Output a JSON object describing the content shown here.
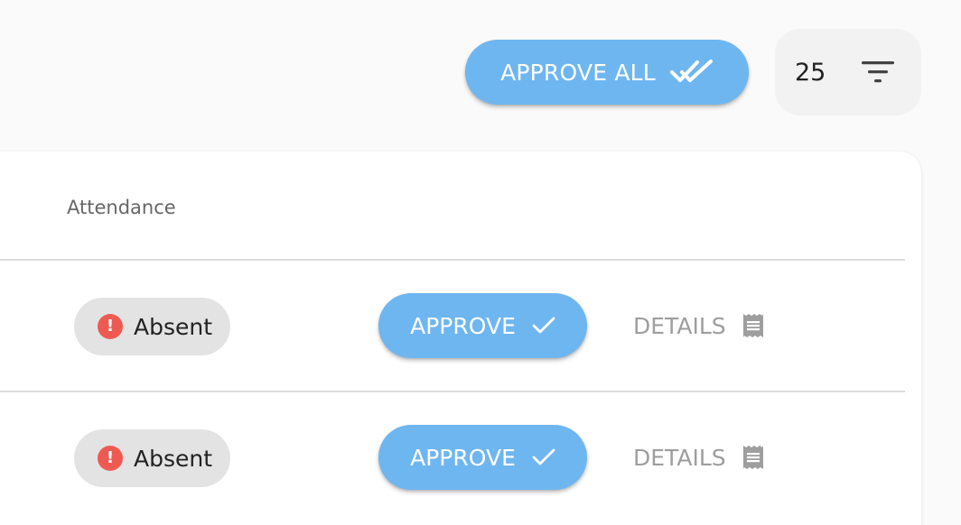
{
  "toolbar": {
    "approve_all_label": "APPROVE ALL",
    "per_page_value": "25"
  },
  "table": {
    "columns": [
      "Attendance"
    ],
    "rows": [
      {
        "status": "Absent",
        "approve_label": "APPROVE",
        "details_label": "DETAILS"
      },
      {
        "status": "Absent",
        "approve_label": "APPROVE",
        "details_label": "DETAILS"
      }
    ]
  },
  "colors": {
    "accent": "#6eb6f0",
    "alert": "#ee5a52",
    "chip_bg": "#e3e3e3",
    "muted_text": "#9e9e9e"
  },
  "icons": {
    "approve_all": "double-check-icon",
    "filter": "filter-list-icon",
    "approve": "check-icon",
    "details": "receipt-icon",
    "status": "alert-circle-icon"
  }
}
